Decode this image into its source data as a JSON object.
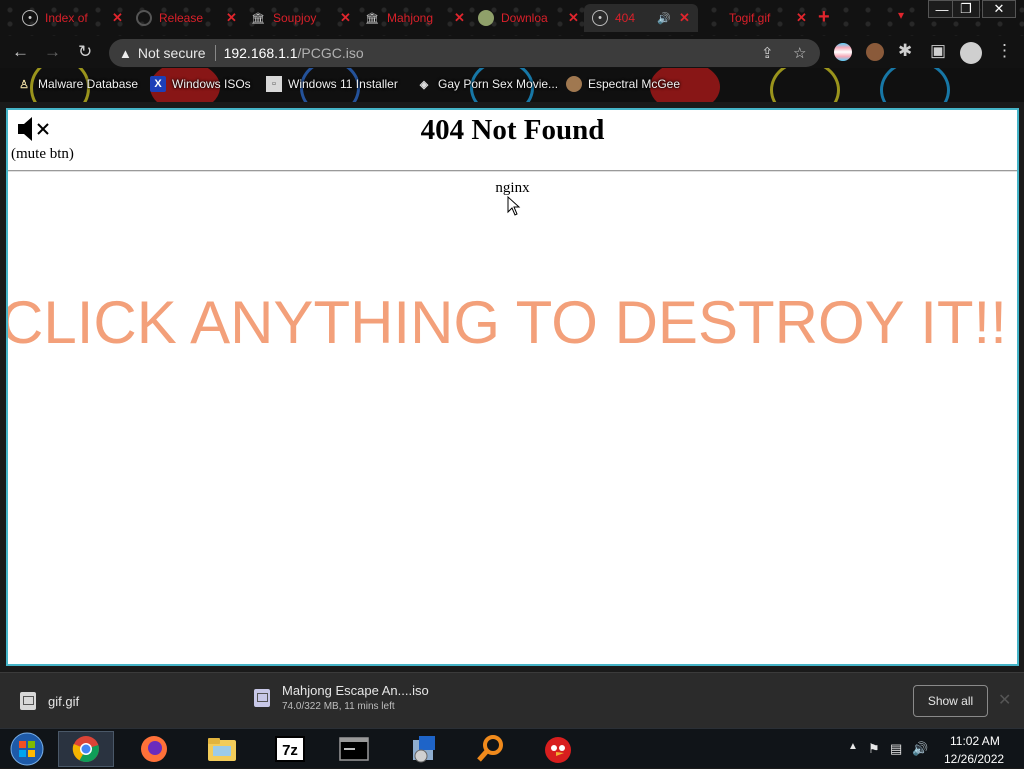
{
  "browser": {
    "tabs": [
      {
        "label": "Index of",
        "icon": "globe-icon"
      },
      {
        "label": "Release",
        "icon": "github-icon"
      },
      {
        "label": "Soupjoy",
        "icon": "museum-icon"
      },
      {
        "label": "Mahjong",
        "icon": "museum-icon"
      },
      {
        "label": "Downloa",
        "icon": "avatar-icon"
      },
      {
        "label": "404",
        "icon": "globe-icon"
      },
      {
        "label": "Togif.gif",
        "icon": "blank-icon"
      }
    ],
    "new_tab": "+",
    "security": "Not secure",
    "url_host": "192.168.1.1",
    "url_path": "/PCGC.iso",
    "bookmarks": [
      {
        "label": "Malware Database",
        "icon": "person-icon"
      },
      {
        "label": "Windows ISOs",
        "icon": "x-logo-icon"
      },
      {
        "label": "Windows 11 Installer",
        "icon": "image-icon"
      },
      {
        "label": "Gay Porn Sex Movie...",
        "icon": "site-icon"
      },
      {
        "label": "Espectral McGee",
        "icon": "avatar-icon"
      }
    ]
  },
  "page": {
    "mute_label": "(mute btn)",
    "heading": "404 Not Found",
    "server": "nginx",
    "overlay_text": "CLICK ANYTHING TO DESTROY IT!!",
    "overlay_color": "#f3a07a",
    "border_color": "#45b4c8"
  },
  "downloads": {
    "items": [
      {
        "name": "gif.gif",
        "status": ""
      },
      {
        "name": "Mahjong Escape An....iso",
        "status": "74.0/322 MB, 11 mins left"
      }
    ],
    "show_all": "Show all"
  },
  "taskbar": {
    "apps": [
      "start-orb",
      "chrome",
      "firefox",
      "file-explorer",
      "7-zip",
      "command-prompt",
      "installer",
      "search-tool",
      "angry-birds"
    ],
    "time": "11:02 AM",
    "date": "12/26/2022"
  }
}
